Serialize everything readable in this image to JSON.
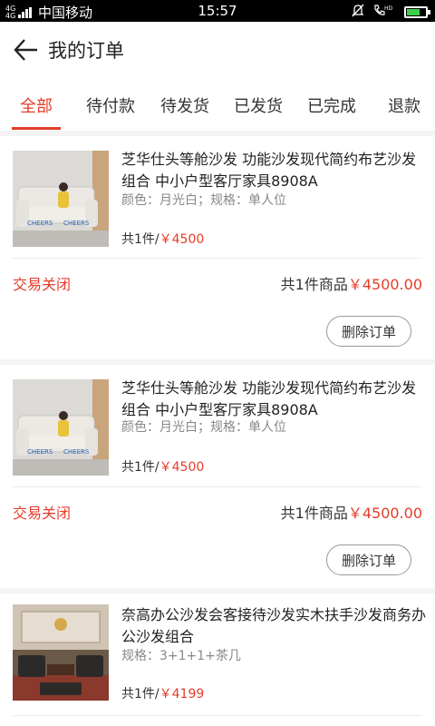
{
  "status_bar": {
    "network": "4G 4G",
    "carrier": "中国移动",
    "time": "15:57",
    "hd_label": "HD"
  },
  "header": {
    "title": "我的订单"
  },
  "tabs": [
    {
      "label": "全部",
      "active": true
    },
    {
      "label": "待付款",
      "active": false
    },
    {
      "label": "待发货",
      "active": false
    },
    {
      "label": "已发货",
      "active": false
    },
    {
      "label": "已完成",
      "active": false
    },
    {
      "label": "退款",
      "active": false
    }
  ],
  "orders": [
    {
      "title": "芝华仕头等舱沙发 功能沙发现代简约布艺沙发组合 中小户型客厅家具8908A",
      "spec": "颜色：月光白；规格：单人位",
      "qty": "共1件/",
      "price": "￥4500",
      "status": "交易关闭",
      "total_label": "共1件商品",
      "total_amount": "￥4500.00",
      "delete_label": "删除订单",
      "image_text": "CHEERS"
    },
    {
      "title": "芝华仕头等舱沙发 功能沙发现代简约布艺沙发组合 中小户型客厅家具8908A",
      "spec": "颜色：月光白；规格：单人位",
      "qty": "共1件/",
      "price": "￥4500",
      "status": "交易关闭",
      "total_label": "共1件商品",
      "total_amount": "￥4500.00",
      "delete_label": "删除订单",
      "image_text": "CHEERS"
    },
    {
      "title": "奈高办公沙发会客接待沙发实木扶手沙发商务办公沙发组合",
      "spec": "规格：3+1+1+茶几",
      "qty": "共1件/",
      "price": "￥4199"
    }
  ],
  "colors": {
    "accent": "#e53c2a",
    "text": "#222222",
    "muted": "#888888",
    "background": "#f4f4f4"
  }
}
